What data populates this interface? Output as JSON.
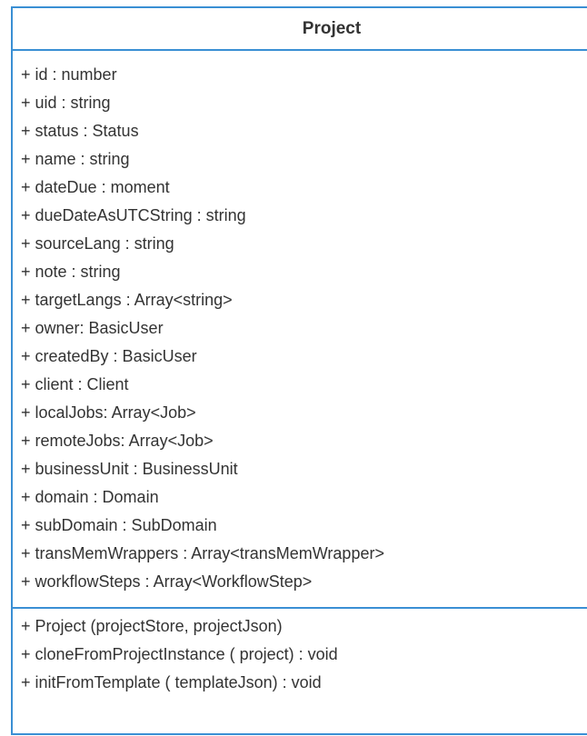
{
  "uml_class": {
    "name": "Project",
    "attributes": [
      "+ id : number",
      "+ uid : string",
      "+ status : Status",
      "+ name : string",
      "+ dateDue : moment",
      "+ dueDateAsUTCString : string",
      "+ sourceLang : string",
      "+ note : string",
      "+ targetLangs : Array<string>",
      "+ owner: BasicUser",
      "+ createdBy : BasicUser",
      "+ client : Client",
      "+ localJobs: Array<Job>",
      "+ remoteJobs: Array<Job>",
      "+ businessUnit : BusinessUnit",
      "+ domain : Domain",
      "+ subDomain : SubDomain",
      "+ transMemWrappers : Array<transMemWrapper>",
      "+ workflowSteps : Array<WorkflowStep>"
    ],
    "methods": [
      "+ Project (projectStore, projectJson)",
      "+ cloneFromProjectInstance ( project) : void",
      "+ initFromTemplate ( templateJson) : void"
    ]
  },
  "colors": {
    "border": "#3a8fd4",
    "text": "#333333",
    "background": "#ffffff"
  }
}
